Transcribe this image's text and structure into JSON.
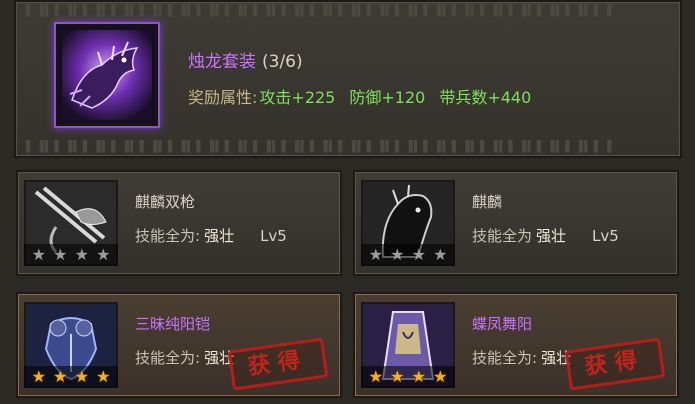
{
  "set": {
    "icon": "dragon-icon",
    "name": "烛龙套装",
    "count": "(3/6)",
    "bonus_label": "奖励属性:",
    "bonuses": [
      "攻击+225",
      "防御+120",
      "带兵数+440"
    ]
  },
  "cards": [
    {
      "name": "麒麟双枪",
      "skill_label": "技能全为:",
      "skill_value": "强壮",
      "level": "Lv5",
      "stars": 4,
      "star_color": "#9c9c9c",
      "owned": false,
      "icon": "spear-icon"
    },
    {
      "name": "麒麟",
      "skill_label": "技能全为",
      "skill_value": "强壮",
      "level": "Lv5",
      "stars": 4,
      "star_color": "#9c9c9c",
      "owned": false,
      "icon": "horse-icon"
    },
    {
      "name": "三昧纯阳铠",
      "skill_label": "技能全为:",
      "skill_value": "强壮",
      "level": "",
      "stars": 4,
      "star_color": "#f3b020",
      "owned": true,
      "stamp": "获得",
      "icon": "armor-icon"
    },
    {
      "name": "蝶凤舞阳",
      "skill_label": "技能全为:",
      "skill_value": "强壮",
      "level": "",
      "stars": 4,
      "star_color": "#f3b020",
      "owned": true,
      "stamp": "获得",
      "icon": "banner-icon"
    }
  ],
  "colors": {
    "set_name": "#c974ff",
    "bonus": "#7ee05a",
    "stamp": "#c3231b"
  }
}
